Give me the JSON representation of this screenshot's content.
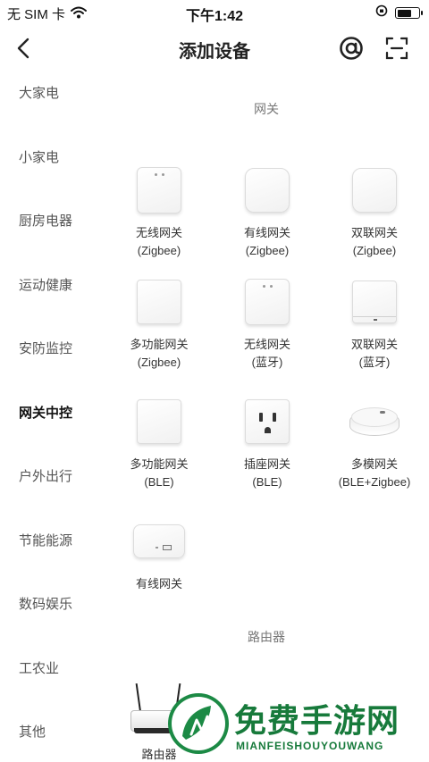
{
  "status_bar": {
    "carrier": "无 SIM 卡",
    "time": "下午1:42",
    "battery_level": 0.7
  },
  "nav": {
    "title": "添加设备",
    "back_icon": "chevron-left-icon",
    "at_icon": "at-icon",
    "scan_icon": "scan-icon"
  },
  "sidebar": {
    "items": [
      {
        "label": "大家电"
      },
      {
        "label": "小家电"
      },
      {
        "label": "厨房电器"
      },
      {
        "label": "运动健康"
      },
      {
        "label": "安防监控"
      },
      {
        "label": "网关中控",
        "active": true
      },
      {
        "label": "户外出行"
      },
      {
        "label": "节能能源"
      },
      {
        "label": "数码娱乐"
      },
      {
        "label": "工农业"
      },
      {
        "label": "其他"
      }
    ]
  },
  "sections": {
    "gateway": {
      "title": "网关",
      "devices": [
        {
          "line1": "无线网关",
          "line2": "(Zigbee)"
        },
        {
          "line1": "有线网关",
          "line2": "(Zigbee)"
        },
        {
          "line1": "双联网关",
          "line2": "(Zigbee)"
        },
        {
          "line1": "多功能网关",
          "line2": "(Zigbee)"
        },
        {
          "line1": "无线网关",
          "line2": "(蓝牙)"
        },
        {
          "line1": "双联网关",
          "line2": "(蓝牙)"
        },
        {
          "line1": "多功能网关",
          "line2": "(BLE)"
        },
        {
          "line1": "插座网关",
          "line2": "(BLE)"
        },
        {
          "line1": "多模网关",
          "line2": "(BLE+Zigbee)"
        },
        {
          "line1": "有线网关",
          "line2": ""
        }
      ]
    },
    "router": {
      "title": "路由器",
      "devices": [
        {
          "line1": "路由器",
          "line2": ""
        }
      ]
    }
  },
  "watermark": {
    "title": "免费手游网",
    "subtitle": "MIANFEISHOUYOUWANG",
    "color": "#177a3b"
  }
}
